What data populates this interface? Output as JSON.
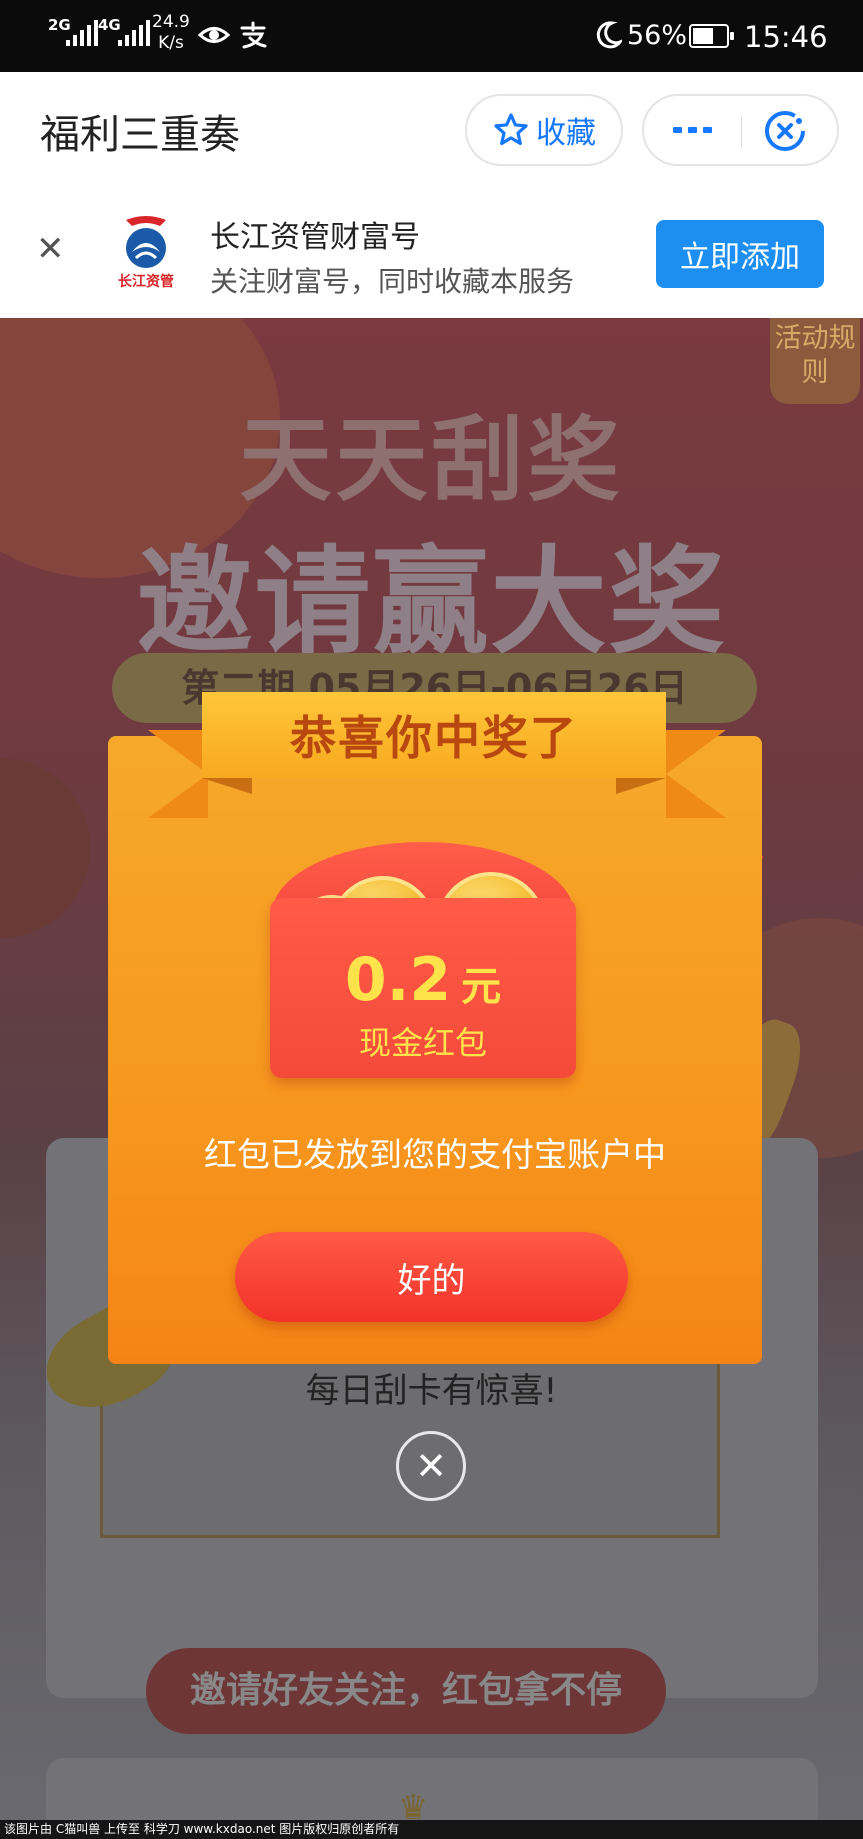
{
  "status_bar": {
    "signal_1": "2G",
    "signal_2": "4G",
    "speed_value": "24.9",
    "speed_unit": "K/s",
    "battery": "56%",
    "time": "15:46"
  },
  "header": {
    "title": "福利三重奏",
    "favorite_label": "收藏"
  },
  "follow_banner": {
    "name": "长江资管财富号",
    "description": "关注财富号，同时收藏本服务",
    "add_label": "立即添加",
    "logo_text": "长江资管"
  },
  "background_page": {
    "rules_tab": "活动规则",
    "headline_1": "天天刮奖",
    "headline_2": "邀请赢大奖",
    "period": "第二期 05月26日-06月26日",
    "card_text": "每日刮卡有惊喜!",
    "invite_banner": "邀请好友关注，红包拿不停"
  },
  "modal": {
    "title": "恭喜你中奖了",
    "amount": "0.2",
    "unit": "元",
    "prize_label": "现金红包",
    "notice": "红包已发放到您的支付宝账户中",
    "ok_label": "好的"
  },
  "footer": {
    "credit": "该图片由 C猫叫兽 上传至 科学刀 www.kxdao.net 图片版权归原创者所有"
  },
  "colors": {
    "accent_blue": "#1677ff",
    "add_button": "#1e8ff2",
    "modal_orange": "#f7971e",
    "banner_gold": "#ffc63a",
    "envelope_red": "#f44a3a",
    "amount_yellow": "#ffe34a"
  }
}
